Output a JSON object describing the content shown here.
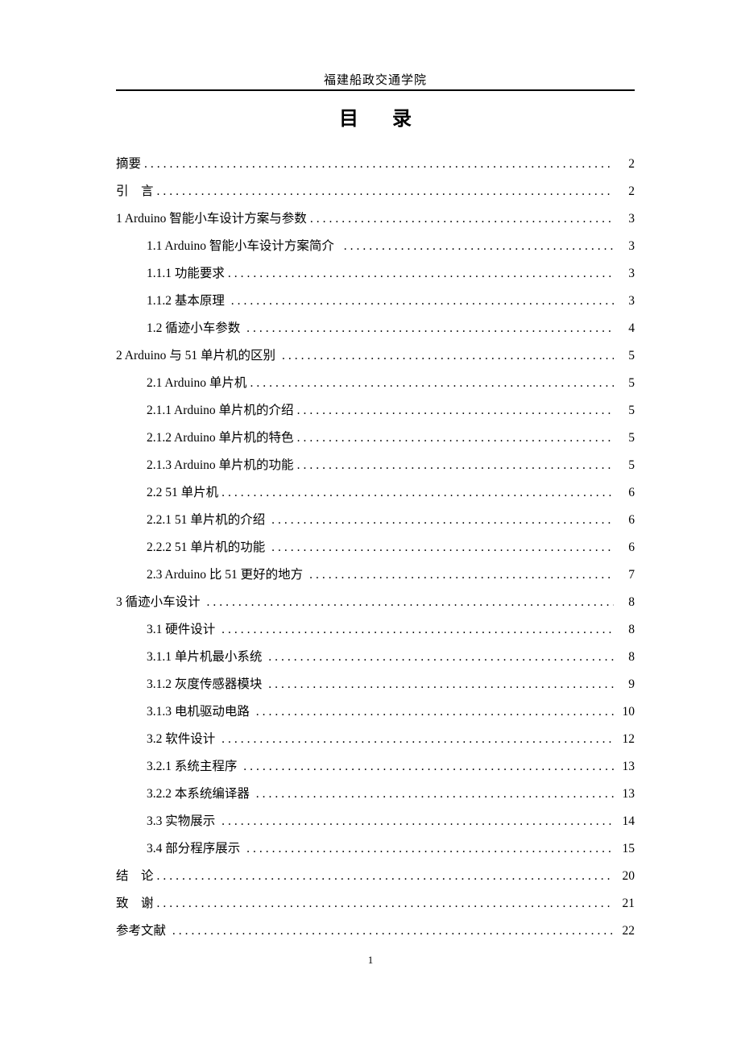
{
  "header": {
    "institution": "福建船政交通学院",
    "toc_title": "目 录"
  },
  "toc": [
    {
      "level": 1,
      "label": "摘要",
      "page": "2"
    },
    {
      "level": 1,
      "label": "引  言",
      "spaced_second": true,
      "page": "2"
    },
    {
      "level": 1,
      "label": "1 Arduino 智能小车设计方案与参数",
      "page": "3"
    },
    {
      "level": 2,
      "label": "1.1 Arduino 智能小车设计方案简介  ",
      "page": "3"
    },
    {
      "level": 2,
      "label": "1.1.1 功能要求",
      "page": "3"
    },
    {
      "level": 2,
      "label": "1.1.2 基本原理 ",
      "page": "3"
    },
    {
      "level": 2,
      "label": "1.2 循迹小车参数 ",
      "page": "4"
    },
    {
      "level": 1,
      "label": "2 Arduino 与 51 单片机的区别 ",
      "page": "5"
    },
    {
      "level": 2,
      "label": "2.1 Arduino 单片机",
      "page": "5"
    },
    {
      "level": 2,
      "label": "2.1.1 Arduino 单片机的介绍",
      "page": "5"
    },
    {
      "level": 2,
      "label": "2.1.2 Arduino 单片机的特色",
      "page": "5"
    },
    {
      "level": 2,
      "label": "2.1.3 Arduino 单片机的功能",
      "page": "5"
    },
    {
      "level": 2,
      "label": "2.2 51 单片机",
      "page": "6"
    },
    {
      "level": 2,
      "label": "2.2.1 51 单片机的介绍 ",
      "page": "6"
    },
    {
      "level": 2,
      "label": "2.2.2 51 单片机的功能 ",
      "page": "6"
    },
    {
      "level": 2,
      "label": "2.3 Arduino 比 51 更好的地方 ",
      "page": "7"
    },
    {
      "level": 1,
      "label": "3 循迹小车设计 ",
      "page": "8"
    },
    {
      "level": 2,
      "label": "3.1 硬件设计 ",
      "page": "8"
    },
    {
      "level": 2,
      "label": "3.1.1 单片机最小系统 ",
      "page": "8"
    },
    {
      "level": 2,
      "label": "3.1.2 灰度传感器模块 ",
      "page": " 9"
    },
    {
      "level": 2,
      "label": "3.1.3 电机驱动电路 ",
      "page": "10"
    },
    {
      "level": 2,
      "label": "3.2 软件设计 ",
      "page": "12"
    },
    {
      "level": 2,
      "label": "3.2.1 系统主程序 ",
      "page": "13"
    },
    {
      "level": 2,
      "label": "3.2.2 本系统编译器 ",
      "page": "13"
    },
    {
      "level": 2,
      "label": "3.3 实物展示 ",
      "page": "14"
    },
    {
      "level": 2,
      "label": "3.4 部分程序展示 ",
      "page": "15"
    },
    {
      "level": 1,
      "label": "结  论",
      "spaced_second": true,
      "page": "20"
    },
    {
      "level": 1,
      "label": "致  谢",
      "spaced_second": true,
      "page": "21"
    },
    {
      "level": 1,
      "label": "参考文献 ",
      "page": "22"
    }
  ],
  "page_number": "1"
}
